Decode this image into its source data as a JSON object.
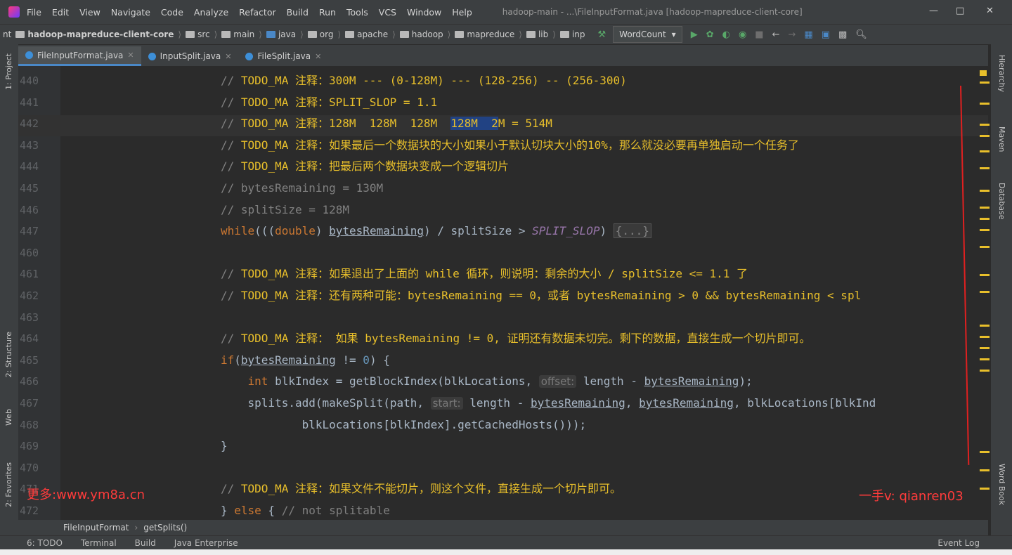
{
  "menu": {
    "items": [
      "File",
      "Edit",
      "View",
      "Navigate",
      "Code",
      "Analyze",
      "Refactor",
      "Build",
      "Run",
      "Tools",
      "VCS",
      "Window",
      "Help"
    ],
    "window_title": "hadoop-main - ...\\FileInputFormat.java [hadoop-mapreduce-client-core]"
  },
  "navbar": {
    "crumbs": [
      "hadoop-mapreduce-client-core",
      "src",
      "main",
      "java",
      "org",
      "apache",
      "hadoop",
      "mapreduce",
      "lib",
      "inp"
    ],
    "run_config": "WordCount"
  },
  "tabs": [
    {
      "label": "FileInputFormat.java",
      "active": true
    },
    {
      "label": "InputSplit.java",
      "active": false
    },
    {
      "label": "FileSplit.java",
      "active": false
    }
  ],
  "left_tools": [
    "1: Project",
    "2: Structure",
    "Web",
    "2: Favorites"
  ],
  "right_tools": [
    "Hierarchy",
    "Maven",
    "Database",
    "Word Book"
  ],
  "lines": [
    {
      "n": "440",
      "parts": [
        [
          "cmt",
          "// "
        ],
        [
          "todo",
          "TODO_MA 注释：300M --- (0-128M) --- (128-256) -- (256-300)"
        ]
      ]
    },
    {
      "n": "441",
      "parts": [
        [
          "cmt",
          "// "
        ],
        [
          "todo",
          "TODO_MA 注释：SPLIT_SLOP = 1.1"
        ]
      ]
    },
    {
      "n": "442",
      "parts": [
        [
          "cmt",
          "// "
        ],
        [
          "todo",
          "TODO_MA 注释：128M  128M  128M  "
        ],
        [
          "sel",
          "128M  2"
        ],
        [
          "todo",
          "M = 514M"
        ]
      ]
    },
    {
      "n": "443",
      "parts": [
        [
          "cmt",
          "// "
        ],
        [
          "todo",
          "TODO_MA 注释：如果最后一个数据块的大小如果小于默认切块大小的10%，那么就没必要再单独启动一个任务了"
        ]
      ]
    },
    {
      "n": "444",
      "parts": [
        [
          "cmt",
          "// "
        ],
        [
          "todo",
          "TODO_MA 注释：把最后两个数据块变成一个逻辑切片"
        ]
      ]
    },
    {
      "n": "445",
      "parts": [
        [
          "cmt",
          "// bytesRemaining = 130M"
        ]
      ]
    },
    {
      "n": "446",
      "parts": [
        [
          "cmt",
          "// splitSize = 128M"
        ]
      ]
    },
    {
      "n": "447",
      "parts": [
        [
          "kw",
          "while"
        ],
        [
          "plain",
          "((("
        ],
        [
          "kw",
          "double"
        ],
        [
          "plain",
          ") "
        ],
        [
          "und",
          "bytesRemaining"
        ],
        [
          "plain",
          ") / splitSize > "
        ],
        [
          "italic",
          "SPLIT_SLOP"
        ],
        [
          "plain",
          ") "
        ],
        [
          "fold",
          "{...}"
        ]
      ]
    },
    {
      "n": "460",
      "parts": []
    },
    {
      "n": "461",
      "parts": [
        [
          "cmt",
          "// "
        ],
        [
          "todo",
          "TODO_MA 注释：如果退出了上面的 while 循环，则说明：剩余的大小 / splitSize <= 1.1 了"
        ]
      ]
    },
    {
      "n": "462",
      "parts": [
        [
          "cmt",
          "// "
        ],
        [
          "todo",
          "TODO_MA 注释：还有两种可能：bytesRemaining == 0，或者 bytesRemaining > 0 && bytesRemaining < spl"
        ]
      ]
    },
    {
      "n": "463",
      "parts": []
    },
    {
      "n": "464",
      "parts": [
        [
          "cmt",
          "// "
        ],
        [
          "todo",
          "TODO_MA 注释： 如果 bytesRemaining != 0, 证明还有数据未切完。剩下的数据，直接生成一个切片即可。"
        ]
      ]
    },
    {
      "n": "465",
      "parts": [
        [
          "kw",
          "if"
        ],
        [
          "plain",
          "("
        ],
        [
          "und",
          "bytesRemaining"
        ],
        [
          "plain",
          " != "
        ],
        [
          "numlit",
          "0"
        ],
        [
          "plain",
          ") {"
        ]
      ]
    },
    {
      "n": "466",
      "parts": [
        [
          "plain",
          "    "
        ],
        [
          "kw",
          "int "
        ],
        [
          "plain",
          "blkIndex = getBlockIndex(blkLocations, "
        ],
        [
          "hint",
          "offset:"
        ],
        [
          "plain",
          " length - "
        ],
        [
          "und",
          "bytesRemaining"
        ],
        [
          "plain",
          ");"
        ]
      ]
    },
    {
      "n": "467",
      "parts": [
        [
          "plain",
          "    splits.add(makeSplit(path, "
        ],
        [
          "hint",
          "start:"
        ],
        [
          "plain",
          " length - "
        ],
        [
          "und",
          "bytesRemaining"
        ],
        [
          "plain",
          ", "
        ],
        [
          "und",
          "bytesRemaining"
        ],
        [
          "plain",
          ", blkLocations[blkInd"
        ]
      ]
    },
    {
      "n": "468",
      "parts": [
        [
          "plain",
          "            blkLocations[blkIndex].getCachedHosts()));"
        ]
      ]
    },
    {
      "n": "469",
      "parts": [
        [
          "plain",
          "}"
        ]
      ]
    },
    {
      "n": "470",
      "parts": []
    },
    {
      "n": "471",
      "parts": [
        [
          "cmt",
          "// "
        ],
        [
          "todo",
          "TODO_MA 注释：如果文件不能切片，则这个文件，直接生成一个切片即可。"
        ]
      ]
    },
    {
      "n": "472",
      "parts": [
        [
          "plain",
          "} "
        ],
        [
          "kw",
          "else"
        ],
        [
          "plain",
          " { "
        ],
        [
          "cmt",
          "// not splitable"
        ]
      ]
    }
  ],
  "bottom_breadcrumb": [
    "FileInputFormat",
    "getSplits()"
  ],
  "status": {
    "todo": "6: TODO",
    "terminal": "Terminal",
    "build": "Build",
    "java_ee": "Java Enterprise",
    "event_log": "Event Log"
  },
  "watermark_left": "更多:www.ym8a.cn",
  "watermark_right": "一手v: qianren03",
  "colors": {
    "todo": "#e8bf2b",
    "keyword": "#cc7832",
    "comment": "#808080",
    "selection": "#214283",
    "watermark": "#ff3b3b"
  }
}
